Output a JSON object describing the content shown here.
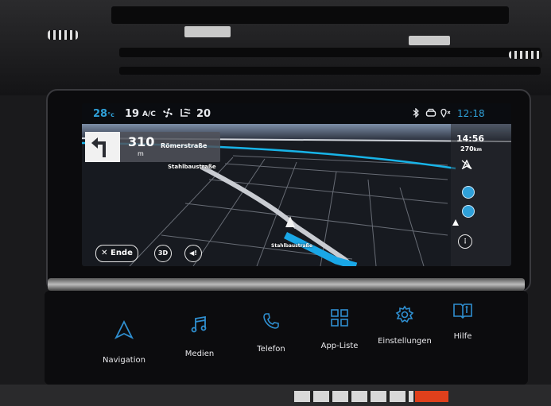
{
  "status": {
    "outside_temp": "28",
    "temp_unit": "°c",
    "cabin_temp": "19",
    "ac_label": "A/C",
    "fan_level": "20",
    "clock": "12:18"
  },
  "navigation": {
    "turn_distance": "310",
    "turn_distance_unit": "m",
    "turn_street": "Römerstraße",
    "current_street": "Stahlbaustraße",
    "street_label_map": "Stahlbaustraße",
    "arrival_time": "14:56",
    "remaining_distance": "270",
    "remaining_unit": "km"
  },
  "controls": {
    "end_label": "Ende",
    "view_3d_label": "3D",
    "voice_label": "◀!"
  },
  "menu": [
    {
      "label": "Navigation",
      "icon": "navigation-arrow-icon"
    },
    {
      "label": "Medien",
      "icon": "music-note-icon"
    },
    {
      "label": "Telefon",
      "icon": "phone-icon"
    },
    {
      "label": "App-Liste",
      "icon": "app-grid-icon"
    },
    {
      "label": "Einstellungen",
      "icon": "gear-icon"
    },
    {
      "label": "Hilfe",
      "icon": "help-book-icon"
    }
  ],
  "colors": {
    "accent": "#2fa0d8",
    "route": "#18b4e8"
  }
}
